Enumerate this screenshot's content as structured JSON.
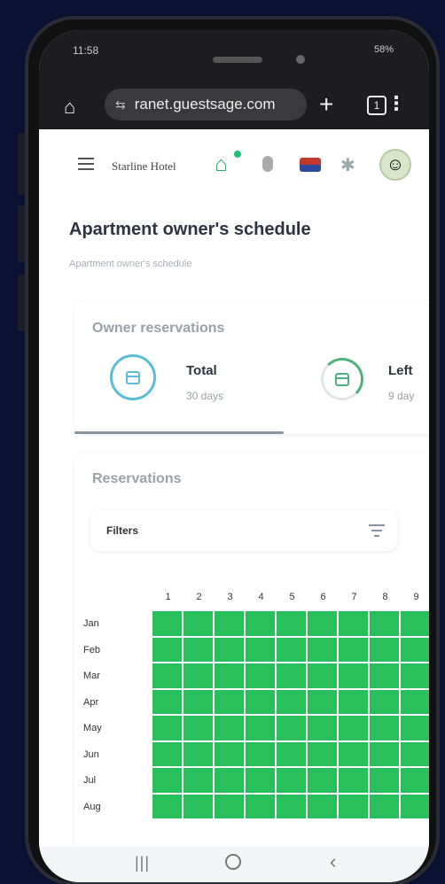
{
  "status": {
    "time": "11:58",
    "right": "58%"
  },
  "browser": {
    "url": "ranet.guestsage.com",
    "tab_count": "1"
  },
  "header": {
    "brand": "Starline Hotel"
  },
  "page": {
    "title": "Apartment owner's schedule",
    "subtitle": "Apartment owner's schedule"
  },
  "owner_reservations": {
    "title": "Owner reservations",
    "total_label": "Total",
    "total_value": "30 days",
    "left_label": "Left",
    "left_value": "9 day"
  },
  "reservations": {
    "title": "Reservations",
    "filters_label": "Filters",
    "days": [
      "1",
      "2",
      "3",
      "4",
      "5",
      "6",
      "7",
      "8",
      "9"
    ],
    "months": [
      "Jan",
      "Feb",
      "Mar",
      "Apr",
      "May",
      "Jun",
      "Jul",
      "Aug"
    ],
    "cell_color": "#27c05a"
  },
  "icons": [
    "home-icon",
    "tune-icon",
    "plus-icon",
    "tabs-icon",
    "more-icon",
    "menu-icon",
    "bot-icon",
    "mic-icon",
    "flag-icon",
    "gear-icon",
    "avatar",
    "calendar-icon",
    "filter-icon"
  ]
}
